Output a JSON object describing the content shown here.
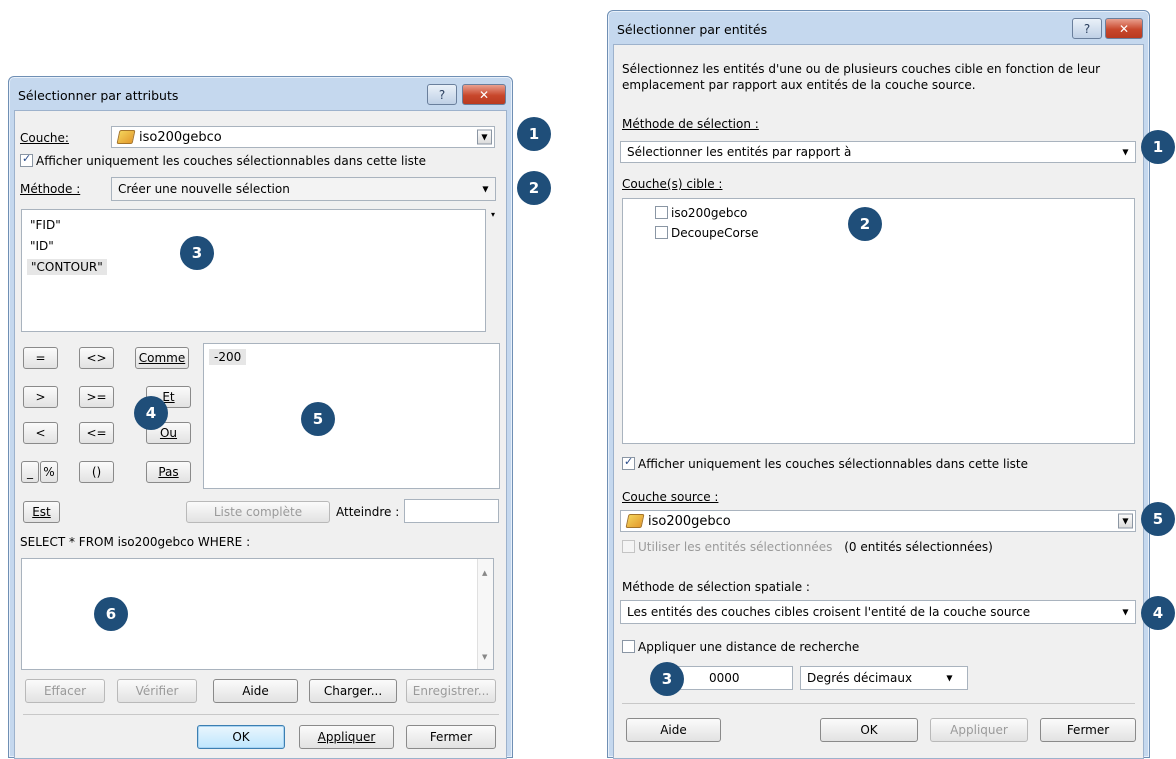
{
  "left_dialog": {
    "title": "Sélectionner par attributs",
    "help_glyph": "?",
    "close_glyph": "✕",
    "couche_label": "Couche:",
    "couche_value": "iso200gebco",
    "show_selectable_label": "Afficher uniquement les couches sélectionnables dans cette liste",
    "methode_label": "Méthode :",
    "methode_value": "Créer une nouvelle sélection",
    "fields": [
      "\"FID\"",
      "\"ID\"",
      "\"CONTOUR\""
    ],
    "operators": {
      "eq": "=",
      "ne": "<>",
      "like": "Comme",
      "gt": ">",
      "ge": ">=",
      "and": "Et",
      "lt": "<",
      "le": "<=",
      "or": "Ou",
      "underscore": "_",
      "percent": "%",
      "parens": "()",
      "not": "Pas",
      "is": "Est"
    },
    "values": [
      "-200"
    ],
    "full_list_label": "Liste complète",
    "goto_label": "Atteindre :",
    "goto_value": "",
    "sql_prefix": "SELECT * FROM iso200gebco WHERE :",
    "expression": "",
    "buttons": {
      "clear": "Effacer",
      "verify": "Vérifier",
      "help": "Aide",
      "load": "Charger...",
      "save": "Enregistrer...",
      "ok": "OK",
      "apply": "Appliquer",
      "close": "Fermer"
    },
    "callouts": [
      "1",
      "2",
      "3",
      "4",
      "5",
      "6"
    ]
  },
  "right_dialog": {
    "title": "Sélectionner par entités",
    "help_glyph": "?",
    "close_glyph": "✕",
    "description": "Sélectionnez les entités d'une ou de plusieurs couches cible en fonction de leur emplacement par rapport aux entités de la couche source.",
    "method_label": "Méthode de sélection :",
    "method_value": "Sélectionner les entités par rapport à",
    "target_layers_label": "Couche(s) cible :",
    "target_layers": [
      {
        "name": "iso200gebco",
        "checked": false
      },
      {
        "name": "DecoupeCorse",
        "checked": false
      }
    ],
    "show_selectable_label": "Afficher uniquement les couches sélectionnables dans cette liste",
    "source_label": "Couche source :",
    "source_value": "iso200gebco",
    "use_selected_label": "Utiliser les entités sélectionnées",
    "selected_count": "(0 entités sélectionnées)",
    "spatial_method_label": "Méthode de sélection spatiale :",
    "spatial_method_value": "Les entités des couches cibles croisent l'entité de la couche source",
    "search_distance_label": "Appliquer une distance de recherche",
    "distance_value": "0000",
    "distance_unit": "Degrés décimaux",
    "buttons": {
      "help": "Aide",
      "ok": "OK",
      "apply": "Appliquer",
      "close": "Fermer"
    },
    "callouts": [
      "1",
      "2",
      "3",
      "4",
      "5"
    ]
  }
}
